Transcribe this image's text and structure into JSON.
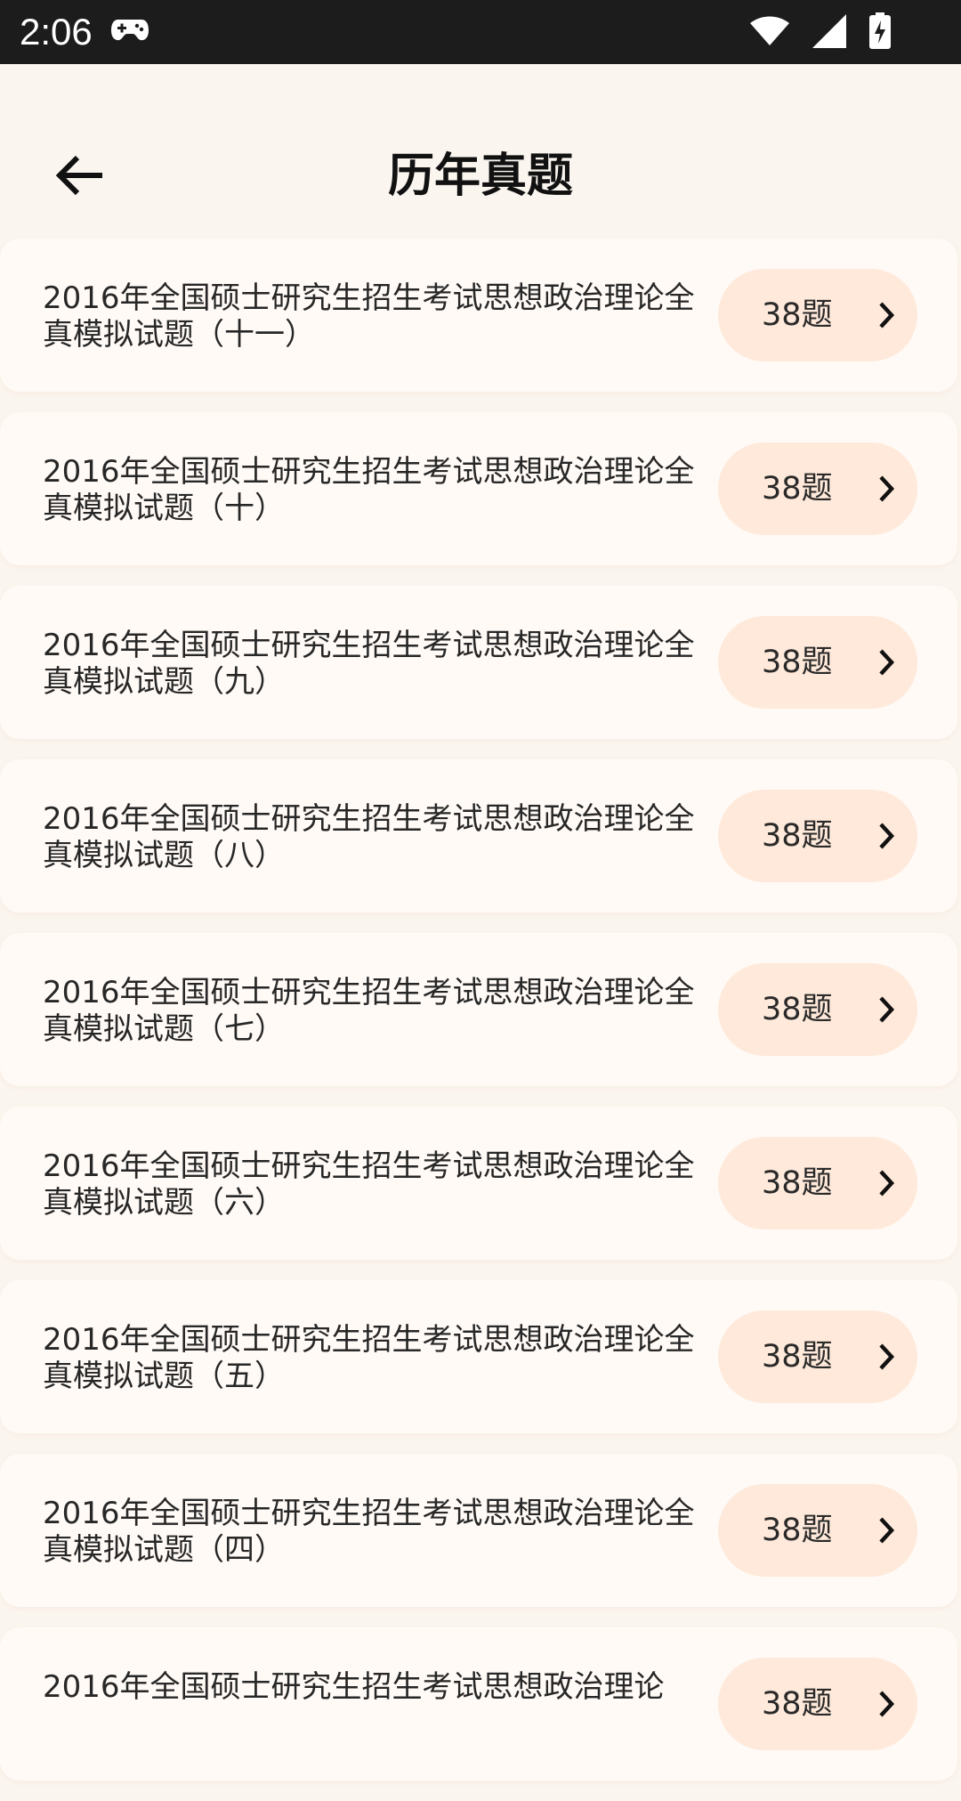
{
  "status_bar": {
    "time": "2:06",
    "icons": [
      "gamepad-icon",
      "wifi-icon",
      "signal-icon",
      "battery-charging-icon"
    ]
  },
  "header": {
    "back_icon": "arrow-left-icon",
    "title": "历年真题"
  },
  "items": [
    {
      "title": "2016年全国硕士研究生招生考试思想政治理论全真模拟试题（十一）",
      "count": "38题"
    },
    {
      "title": "2016年全国硕士研究生招生考试思想政治理论全真模拟试题（十）",
      "count": "38题"
    },
    {
      "title": "2016年全国硕士研究生招生考试思想政治理论全真模拟试题（九）",
      "count": "38题"
    },
    {
      "title": "2016年全国硕士研究生招生考试思想政治理论全真模拟试题（八）",
      "count": "38题"
    },
    {
      "title": "2016年全国硕士研究生招生考试思想政治理论全真模拟试题（七）",
      "count": "38题"
    },
    {
      "title": "2016年全国硕士研究生招生考试思想政治理论全真模拟试题（六）",
      "count": "38题"
    },
    {
      "title": "2016年全国硕士研究生招生考试思想政治理论全真模拟试题（五）",
      "count": "38题"
    },
    {
      "title": "2016年全国硕士研究生招生考试思想政治理论全真模拟试题（四）",
      "count": "38题"
    },
    {
      "title": "2016年全国硕士研究生招生考试思想政治理论",
      "count": "38题"
    }
  ],
  "colors": {
    "background": "#fbf5ef",
    "card": "#fffaf6",
    "pill": "#ffe9da",
    "status_bar": "#1c1c1c"
  }
}
